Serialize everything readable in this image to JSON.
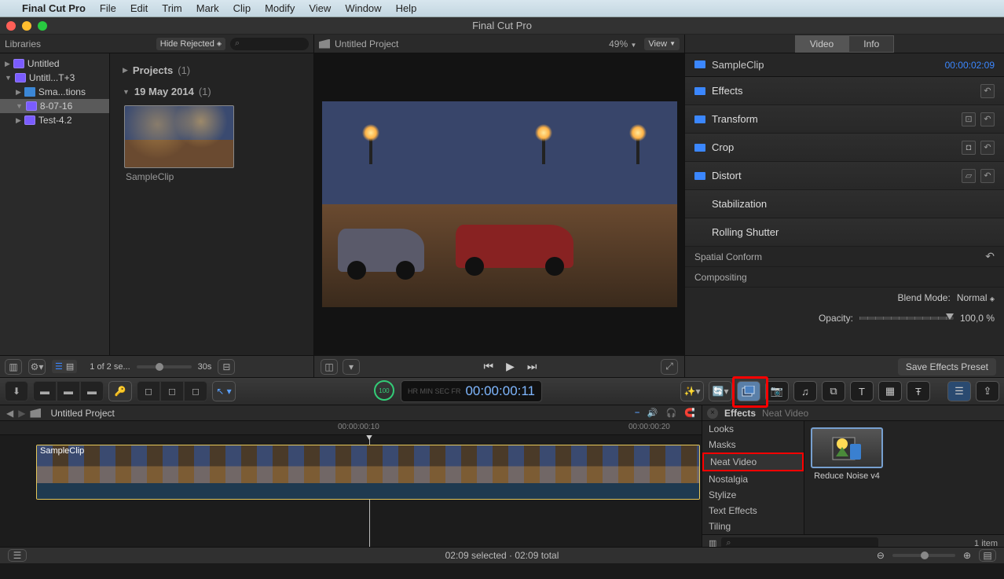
{
  "menubar": {
    "appname": "Final Cut Pro",
    "items": [
      "File",
      "Edit",
      "Trim",
      "Mark",
      "Clip",
      "Modify",
      "View",
      "Window",
      "Help"
    ]
  },
  "titlebar": {
    "title": "Final Cut Pro"
  },
  "libraries": {
    "header_label": "Libraries",
    "hide_rejected": "Hide Rejected",
    "tree": [
      {
        "icon": "purple",
        "label": "Untitled",
        "indent": 0,
        "tri": "▶"
      },
      {
        "icon": "purple",
        "label": "Untitl...T+3",
        "indent": 0,
        "tri": "▼"
      },
      {
        "icon": "folder",
        "label": "Sma...tions",
        "indent": 1,
        "tri": "▶"
      },
      {
        "icon": "purple",
        "label": "8-07-16",
        "indent": 1,
        "tri": "▼",
        "sel": true
      },
      {
        "icon": "purple",
        "label": "Test-4.2",
        "indent": 1,
        "tri": "▶"
      }
    ],
    "projects": {
      "label": "Projects",
      "count": "(1)"
    },
    "event": {
      "label": "19 May 2014",
      "count": "(1)"
    },
    "thumb_label": "SampleClip",
    "footer_text": "1 of 2 se...",
    "footer_zoom": "30s"
  },
  "viewer": {
    "title": "Untitled Project",
    "zoom": "49%",
    "view_label": "View"
  },
  "inspector": {
    "tabs": [
      "Video",
      "Info"
    ],
    "active_tab": "Video",
    "clip_name": "SampleClip",
    "clip_tc": "00:00:02:09",
    "rows": [
      {
        "label": "Effects",
        "icon": "blue",
        "undo": true
      },
      {
        "label": "Transform",
        "icon": "blue",
        "tool": "⊡",
        "undo": true
      },
      {
        "label": "Crop",
        "icon": "blue",
        "tool": "◘",
        "undo": true
      },
      {
        "label": "Distort",
        "icon": "blue",
        "tool": "▱",
        "undo": true
      },
      {
        "label": "Stabilization",
        "icon": "none"
      },
      {
        "label": "Rolling Shutter",
        "icon": "none"
      }
    ],
    "spatial": "Spatial Conform",
    "compositing": "Compositing",
    "blend_label": "Blend Mode:",
    "blend_value": "Normal",
    "opacity_label": "Opacity:",
    "opacity_value": "100,0 %",
    "save_preset": "Save Effects Preset"
  },
  "toolbar": {
    "timecode": "00:00:00:11",
    "dial": "100"
  },
  "timeline": {
    "header": "Untitled Project",
    "ticks": [
      {
        "pos": 430,
        "label": "00:00:00:10"
      },
      {
        "pos": 800,
        "label": "00:00:00:20"
      }
    ],
    "clip_label": "SampleClip"
  },
  "fx": {
    "title": "Effects",
    "subtitle": "Neat Video",
    "categories": [
      "Looks",
      "Masks",
      "Neat Video",
      "Nostalgia",
      "Stylize",
      "Text Effects",
      "Tiling"
    ],
    "highlight": "Neat Video",
    "item": "Reduce Noise v4",
    "count": "1 item"
  },
  "status": {
    "mid": "02:09 selected · 02:09 total"
  }
}
